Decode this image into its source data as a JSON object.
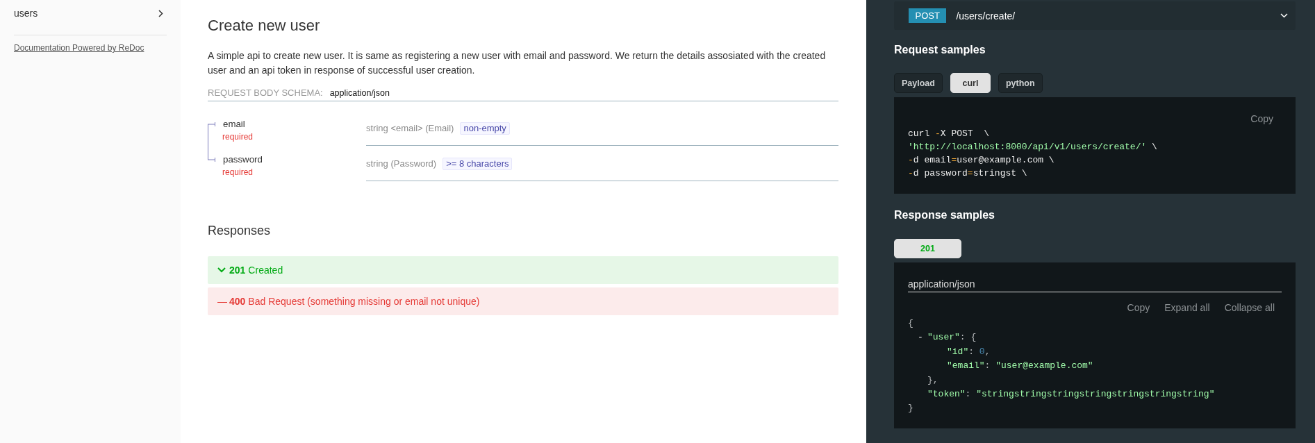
{
  "sidebar": {
    "items": [
      {
        "label": "users",
        "selected": false,
        "expanded": false
      }
    ],
    "footer_link": "Documentation Powered by ReDoc"
  },
  "operation": {
    "title": "Create new user",
    "description": "A simple api to create new user. It is same as registering a new user with email and password. We return the details assosiated with the created user and an api token in response of successful user creation.",
    "request_body": {
      "label": "REQUEST BODY SCHEMA:",
      "media_type": "application/json",
      "fields": [
        {
          "name": "email",
          "required": "required",
          "type": "string <email> (Email)",
          "constraint": "non-empty"
        },
        {
          "name": "password",
          "required": "required",
          "type": "string (Password)",
          "constraint": ">= 8 characters"
        }
      ]
    },
    "responses_title": "Responses",
    "responses": [
      {
        "color": "#00aa13",
        "code": "201",
        "description": "Created"
      },
      {
        "color": "#e53935",
        "marker": "—",
        "code": "400",
        "description": "Bad Request (something missing or email not unique)"
      }
    ]
  },
  "endpoint": {
    "method": "POST",
    "path": "/users/create/",
    "expanded": false
  },
  "request_samples": {
    "title": "Request samples",
    "tabs": [
      {
        "label": "Payload",
        "selected": false
      },
      {
        "label": "curl",
        "selected": true
      },
      {
        "label": "python",
        "selected": false
      }
    ],
    "copy": "Copy",
    "lines": [
      [
        {
          "kind": "plain",
          "text": "curl "
        },
        {
          "kind": "operator",
          "text": "-"
        },
        {
          "kind": "plain",
          "text": "X POST  \\"
        }
      ],
      [
        {
          "kind": "string",
          "text": "'http://localhost:8000/api/v1/users/create/'"
        },
        {
          "kind": "plain",
          "text": " \\"
        }
      ],
      [
        {
          "kind": "operator",
          "text": "-"
        },
        {
          "kind": "plain",
          "text": "d email"
        },
        {
          "kind": "operator",
          "text": "="
        },
        {
          "kind": "plain",
          "text": "user@example.com \\"
        }
      ],
      [
        {
          "kind": "operator",
          "text": "-"
        },
        {
          "kind": "plain",
          "text": "d password"
        },
        {
          "kind": "operator",
          "text": "="
        },
        {
          "kind": "plain",
          "text": "stringst \\"
        }
      ]
    ]
  },
  "response_samples": {
    "title": "Response samples",
    "tabs": [
      {
        "label": "201",
        "color": "#00aa13",
        "selected": true
      }
    ],
    "media_type": "application/json",
    "actions": {
      "copy": "Copy",
      "expand_all": "Expand all",
      "collapse_all": "Collapse all"
    },
    "body": {
      "open": "{",
      "close": "}",
      "children": [
        {
          "toggle": "-",
          "key": "\"user\"",
          "sep": ": ",
          "open": "{",
          "close": "},",
          "children": [
            {
              "key": "\"id\"",
              "sep": ": ",
              "value": "0",
              "kind": "number",
              "comma": ","
            },
            {
              "key": "\"email\"",
              "sep": ": ",
              "value": "\"user@example.com\"",
              "kind": "string"
            }
          ]
        },
        {
          "key": "\"token\"",
          "sep": ": ",
          "value": "\"stringstringstringstringstringstringstring\"",
          "kind": "string"
        }
      ]
    }
  }
}
